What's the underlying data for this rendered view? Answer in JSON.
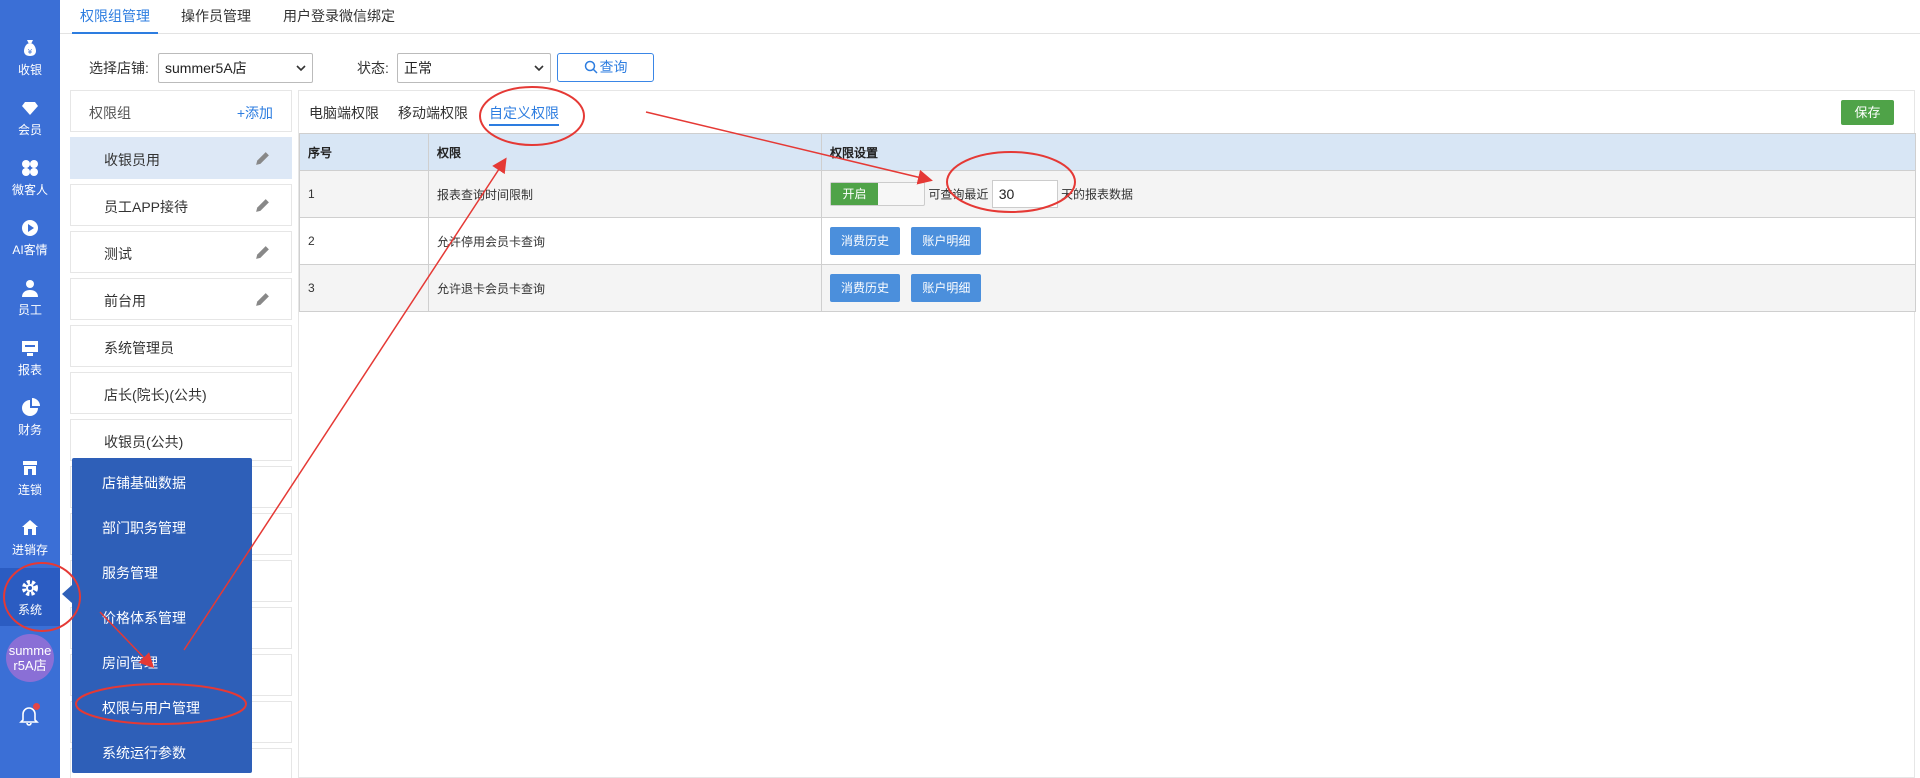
{
  "rail": {
    "items": [
      {
        "label": "收银",
        "icon": "cashier-icon"
      },
      {
        "label": "会员",
        "icon": "diamond-icon"
      },
      {
        "label": "微客人",
        "icon": "clover-icon"
      },
      {
        "label": "AI客情",
        "icon": "play-circle-icon"
      },
      {
        "label": "员工",
        "icon": "person-icon"
      },
      {
        "label": "报表",
        "icon": "monitor-icon"
      },
      {
        "label": "财务",
        "icon": "pie-icon"
      },
      {
        "label": "连锁",
        "icon": "store-icon"
      },
      {
        "label": "进销存",
        "icon": "house-icon"
      },
      {
        "label": "系统",
        "icon": "gear-icon"
      }
    ],
    "avatar_line1": "summe",
    "avatar_line2": "r5A店"
  },
  "top_tabs": [
    "权限组管理",
    "操作员管理",
    "用户登录微信绑定"
  ],
  "filters": {
    "store_label": "选择店铺:",
    "store_value": "summer5A店",
    "status_label": "状态:",
    "status_value": "正常",
    "query_label": "查询"
  },
  "groups": {
    "title": "权限组",
    "add_label": "+添加",
    "items": [
      "收银员用",
      "员工APP接待",
      "测试",
      "前台用",
      "系统管理员",
      "店长(院长)(公共)",
      "收银员(公共)"
    ]
  },
  "system_menu": [
    "店铺基础数据",
    "部门职务管理",
    "服务管理",
    "价格体系管理",
    "房间管理",
    "权限与用户管理",
    "系统运行参数"
  ],
  "main": {
    "sub_tabs": [
      "电脑端权限",
      "移动端权限",
      "自定义权限"
    ],
    "save_label": "保存",
    "columns": [
      "序号",
      "权限",
      "权限设置"
    ],
    "rows": [
      {
        "no": "1",
        "name": "报表查询时间限制"
      },
      {
        "no": "2",
        "name": "允许停用会员卡查询"
      },
      {
        "no": "3",
        "name": "允许退卡会员卡查询"
      }
    ],
    "toggle_label": "开启",
    "query_prefix": "可查询最近",
    "days_value": "30",
    "query_suffix": "天的报表数据",
    "btn_history": "消费历史",
    "btn_account": "账户明细"
  },
  "colors": {
    "rail": "#3b6fd6",
    "accent": "#2d7de0",
    "save": "#4fa348",
    "annotation": "#e53935"
  }
}
